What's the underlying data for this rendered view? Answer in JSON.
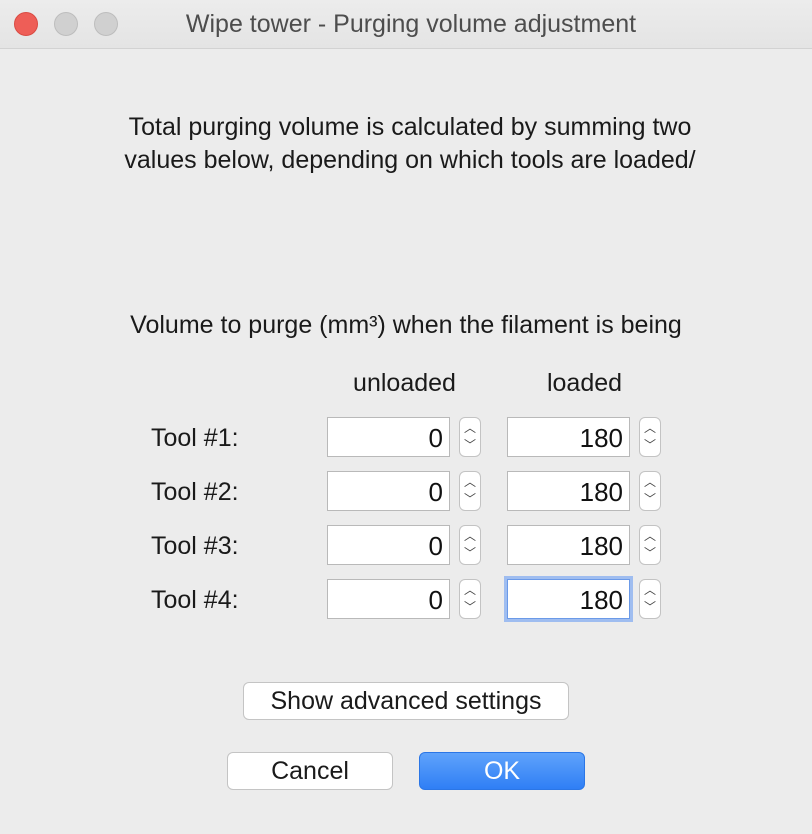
{
  "window": {
    "title": "Wipe tower - Purging volume adjustment"
  },
  "intro": {
    "line1": "Total purging volume is calculated by summing two",
    "line2": "values below, depending on which tools are loaded/"
  },
  "volume": {
    "heading": "Volume to purge (mm³) when the filament is being",
    "columns": {
      "unloaded": "unloaded",
      "loaded": "loaded"
    },
    "tools": [
      {
        "label": "Tool #1:",
        "unloaded": "0",
        "loaded": "180"
      },
      {
        "label": "Tool #2:",
        "unloaded": "0",
        "loaded": "180"
      },
      {
        "label": "Tool #3:",
        "unloaded": "0",
        "loaded": "180"
      },
      {
        "label": "Tool #4:",
        "unloaded": "0",
        "loaded": "180"
      }
    ]
  },
  "buttons": {
    "advanced": "Show advanced settings",
    "cancel": "Cancel",
    "ok": "OK"
  },
  "colors": {
    "close_button": "#ee5e57",
    "primary_button": "#2f7ff5",
    "focus_ring": "#9fbdf0"
  },
  "icons": {
    "close": "close-icon",
    "minimize": "minimize-icon",
    "maximize": "maximize-icon",
    "stepper_up": "chevron-up-icon",
    "stepper_down": "chevron-down-icon"
  }
}
